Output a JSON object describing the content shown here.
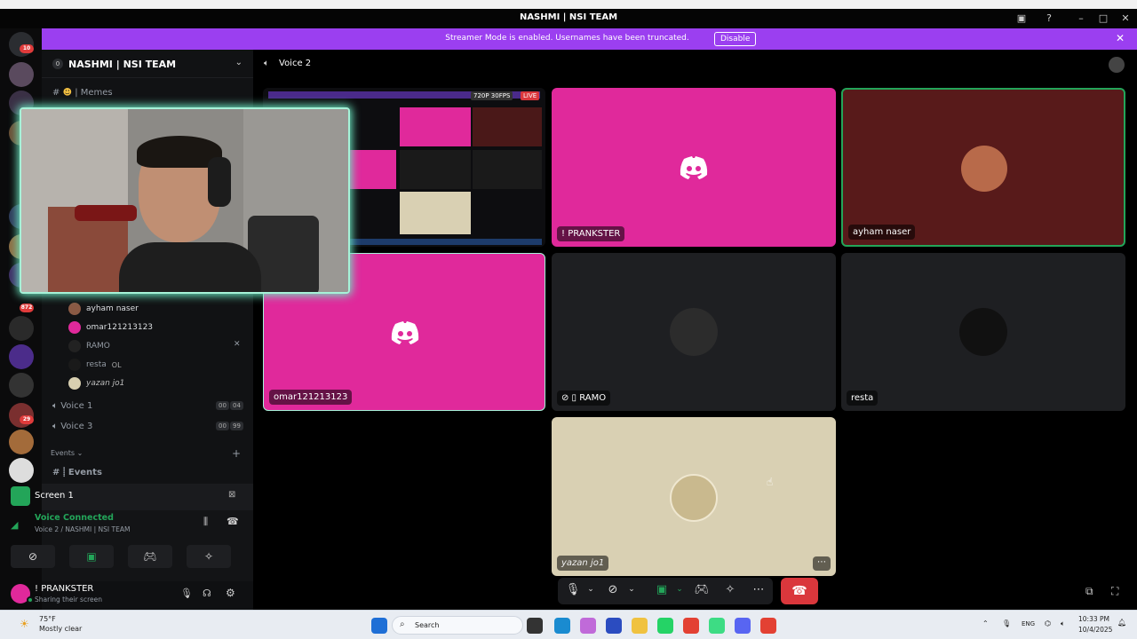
{
  "window": {
    "title": "NASHMI | NSI TEAM"
  },
  "banner": {
    "text": "Streamer Mode is enabled. Usernames have been truncated.",
    "button": "Disable"
  },
  "rail": {
    "badges": [
      "10",
      "872",
      "29"
    ]
  },
  "server": {
    "name": "NASHMI | NSI TEAM",
    "id_badge": "0"
  },
  "channels": {
    "memes": "| Memes",
    "voice_1": "Voice 1",
    "voice_1_counts": [
      "00",
      "04"
    ],
    "voice_3": "Voice 3",
    "voice_3_counts": [
      "00",
      "99"
    ],
    "events_category": "Events",
    "events_channel": "Events"
  },
  "members": [
    {
      "name": "ayham naser"
    },
    {
      "name": "omar121213123"
    },
    {
      "name": "RAMO"
    },
    {
      "name": "resta",
      "tag": "OL"
    },
    {
      "name": "yazan jo1"
    }
  ],
  "screen": {
    "label": "Screen 1"
  },
  "voice": {
    "status": "Voice Connected",
    "location": "Voice 2 / NASHMI | NSI TEAM"
  },
  "user": {
    "name": "! PRANKSTER",
    "status": "Sharing their screen"
  },
  "stage": {
    "channel": "Voice 2",
    "stream_quality": "720P 30FPS",
    "live": "LIVE",
    "tiles": [
      {
        "label": "! PRANKSTER"
      },
      {
        "label": "ayham naser"
      },
      {
        "label": "omar121213123"
      },
      {
        "label": "RAMO"
      },
      {
        "label": "resta"
      },
      {
        "label": "yazan jo1"
      }
    ]
  },
  "taskbar": {
    "weather_temp": "75°F",
    "weather_desc": "Mostly clear",
    "search": "Search",
    "lang": "ENG",
    "time": "10:33 PM",
    "date": "10/4/2025"
  },
  "colors": {
    "accent": "#9b3ff0",
    "discord_pink": "#e0299b",
    "green": "#23a559",
    "danger": "#da373c"
  }
}
